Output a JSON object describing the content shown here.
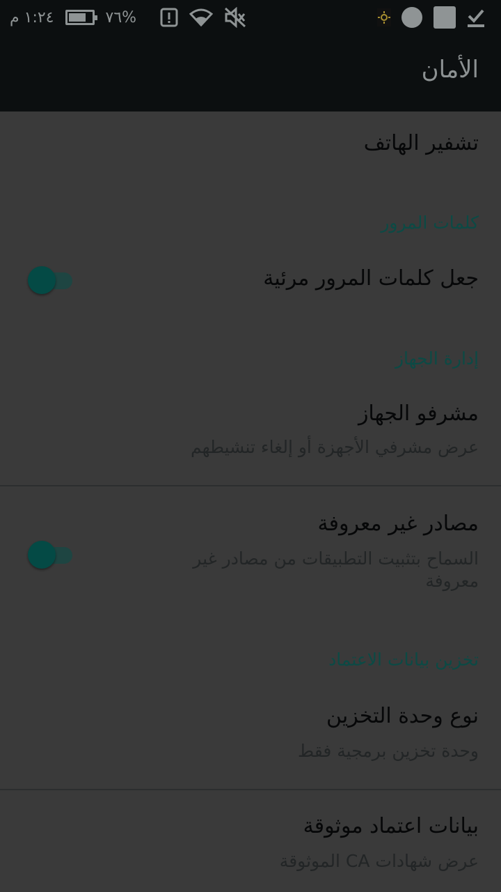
{
  "status_bar": {
    "time": "١:٢٤ م",
    "battery_level": "٧٦%",
    "battery_fraction": 0.76,
    "icons": [
      "alert-icon",
      "wifi-icon",
      "mute-icon",
      "brightness-icon",
      "circle-icon",
      "square-icon",
      "download-done-icon"
    ]
  },
  "app_bar": {
    "title": "الأمان"
  },
  "items": {
    "encryption": {
      "title": "تشفير الهاتف"
    },
    "passwords_section": "كلمات المرور",
    "show_passwords": {
      "title": "جعل كلمات المرور مرئية",
      "enabled": false
    },
    "device_admin_section": "إدارة الجهاز",
    "device_admins": {
      "title": "مشرفو الجهاز",
      "subtitle": "عرض مشرفي الأجهزة أو إلغاء تنشيطهم"
    },
    "unknown_sources": {
      "title": "مصادر غير معروفة",
      "subtitle": "السماح بتثبيت التطبيقات من مصادر غير معروفة",
      "enabled": false
    },
    "credential_section": "تخزين بيانات الاعتماد",
    "storage_type": {
      "title": "نوع وحدة التخزين",
      "subtitle": "وحدة تخزين برمجية فقط"
    },
    "trusted_credentials": {
      "title": "بيانات اعتماد موثوقة",
      "subtitle": "عرض شهادات CA الموثوقة"
    }
  },
  "colors": {
    "accent": "#0c4a45",
    "toggle_thumb": "#044a45",
    "bar_bg": "#0c0f10",
    "content_bg": "#3a3a3a"
  }
}
